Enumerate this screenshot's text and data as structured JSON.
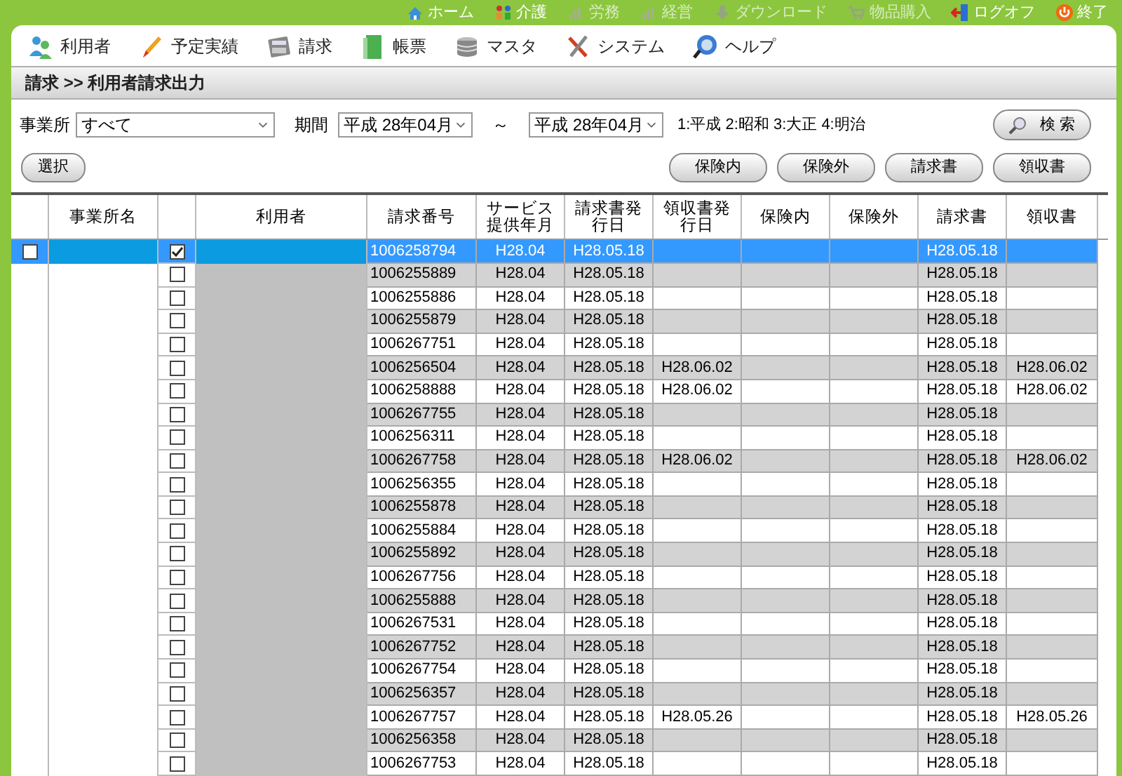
{
  "top_links": [
    {
      "label": "ホーム",
      "disabled": false
    },
    {
      "label": "介護",
      "disabled": false
    },
    {
      "label": "労務",
      "disabled": true
    },
    {
      "label": "経営",
      "disabled": true
    },
    {
      "label": "ダウンロード",
      "disabled": true
    },
    {
      "label": "物品購入",
      "disabled": true
    },
    {
      "label": "ログオフ",
      "disabled": false
    },
    {
      "label": "終了",
      "disabled": false
    }
  ],
  "menu": [
    {
      "label": "利用者"
    },
    {
      "label": "予定実績"
    },
    {
      "label": "請求"
    },
    {
      "label": "帳票"
    },
    {
      "label": "マスタ"
    },
    {
      "label": "システム"
    },
    {
      "label": "ヘルプ"
    }
  ],
  "breadcrumb": "請求 >> 利用者請求出力",
  "filters": {
    "office_label": "事業所",
    "office": "すべて",
    "period_label": "期間",
    "period_from": "平成 28年04月",
    "tilde": "～",
    "period_to": "平成 28年04月",
    "era_legend": "1:平成 2:昭和 3:大正 4:明治",
    "search_button": "検 索"
  },
  "select_button": "選択",
  "print_buttons": [
    "保険内",
    "保険外",
    "請求書",
    "領収書"
  ],
  "table": {
    "columns": [
      "事業所名",
      "利用者",
      "請求番号",
      "サービス提供年月",
      "請求書発行日",
      "領収書発行日",
      "保険内",
      "保険外",
      "請求書",
      "領収書"
    ],
    "group_checked": false,
    "rows": [
      {
        "selected": true,
        "checked": true,
        "invoice_no": "1006258794",
        "service_month": "H28.04",
        "bill_issued": "H28.05.18",
        "bill": "H28.05.18"
      },
      {
        "selected": false,
        "checked": false,
        "invoice_no": "1006255889",
        "service_month": "H28.04",
        "bill_issued": "H28.05.18",
        "bill": "H28.05.18"
      },
      {
        "selected": false,
        "checked": false,
        "invoice_no": "1006255886",
        "service_month": "H28.04",
        "bill_issued": "H28.05.18",
        "bill": "H28.05.18"
      },
      {
        "selected": false,
        "checked": false,
        "invoice_no": "1006255879",
        "service_month": "H28.04",
        "bill_issued": "H28.05.18",
        "bill": "H28.05.18"
      },
      {
        "selected": false,
        "checked": false,
        "invoice_no": "1006267751",
        "service_month": "H28.04",
        "bill_issued": "H28.05.18",
        "bill": "H28.05.18"
      },
      {
        "selected": false,
        "checked": false,
        "invoice_no": "1006256504",
        "service_month": "H28.04",
        "bill_issued": "H28.05.18",
        "receipt_issued": "H28.06.02",
        "bill": "H28.05.18",
        "receipt": "H28.06.02"
      },
      {
        "selected": false,
        "checked": false,
        "invoice_no": "1006258888",
        "service_month": "H28.04",
        "bill_issued": "H28.05.18",
        "receipt_issued": "H28.06.02",
        "bill": "H28.05.18",
        "receipt": "H28.06.02"
      },
      {
        "selected": false,
        "checked": false,
        "invoice_no": "1006267755",
        "service_month": "H28.04",
        "bill_issued": "H28.05.18",
        "bill": "H28.05.18"
      },
      {
        "selected": false,
        "checked": false,
        "invoice_no": "1006256311",
        "service_month": "H28.04",
        "bill_issued": "H28.05.18",
        "bill": "H28.05.18"
      },
      {
        "selected": false,
        "checked": false,
        "invoice_no": "1006267758",
        "service_month": "H28.04",
        "bill_issued": "H28.05.18",
        "receipt_issued": "H28.06.02",
        "bill": "H28.05.18",
        "receipt": "H28.06.02"
      },
      {
        "selected": false,
        "checked": false,
        "invoice_no": "1006256355",
        "service_month": "H28.04",
        "bill_issued": "H28.05.18",
        "bill": "H28.05.18"
      },
      {
        "selected": false,
        "checked": false,
        "invoice_no": "1006255878",
        "service_month": "H28.04",
        "bill_issued": "H28.05.18",
        "bill": "H28.05.18"
      },
      {
        "selected": false,
        "checked": false,
        "invoice_no": "1006255884",
        "service_month": "H28.04",
        "bill_issued": "H28.05.18",
        "bill": "H28.05.18"
      },
      {
        "selected": false,
        "checked": false,
        "invoice_no": "1006255892",
        "service_month": "H28.04",
        "bill_issued": "H28.05.18",
        "bill": "H28.05.18"
      },
      {
        "selected": false,
        "checked": false,
        "invoice_no": "1006267756",
        "service_month": "H28.04",
        "bill_issued": "H28.05.18",
        "bill": "H28.05.18"
      },
      {
        "selected": false,
        "checked": false,
        "invoice_no": "1006255888",
        "service_month": "H28.04",
        "bill_issued": "H28.05.18",
        "bill": "H28.05.18"
      },
      {
        "selected": false,
        "checked": false,
        "invoice_no": "1006267531",
        "service_month": "H28.04",
        "bill_issued": "H28.05.18",
        "bill": "H28.05.18"
      },
      {
        "selected": false,
        "checked": false,
        "invoice_no": "1006267752",
        "service_month": "H28.04",
        "bill_issued": "H28.05.18",
        "bill": "H28.05.18"
      },
      {
        "selected": false,
        "checked": false,
        "invoice_no": "1006267754",
        "service_month": "H28.04",
        "bill_issued": "H28.05.18",
        "bill": "H28.05.18"
      },
      {
        "selected": false,
        "checked": false,
        "invoice_no": "1006256357",
        "service_month": "H28.04",
        "bill_issued": "H28.05.18",
        "bill": "H28.05.18"
      },
      {
        "selected": false,
        "checked": false,
        "invoice_no": "1006267757",
        "service_month": "H28.04",
        "bill_issued": "H28.05.18",
        "receipt_issued": "H28.05.26",
        "bill": "H28.05.18",
        "receipt": "H28.05.26"
      },
      {
        "selected": false,
        "checked": false,
        "invoice_no": "1006256358",
        "service_month": "H28.04",
        "bill_issued": "H28.05.18",
        "bill": "H28.05.18"
      },
      {
        "selected": false,
        "checked": false,
        "invoice_no": "1006267753",
        "service_month": "H28.04",
        "bill_issued": "H28.05.18",
        "bill": "H28.05.18"
      }
    ]
  }
}
